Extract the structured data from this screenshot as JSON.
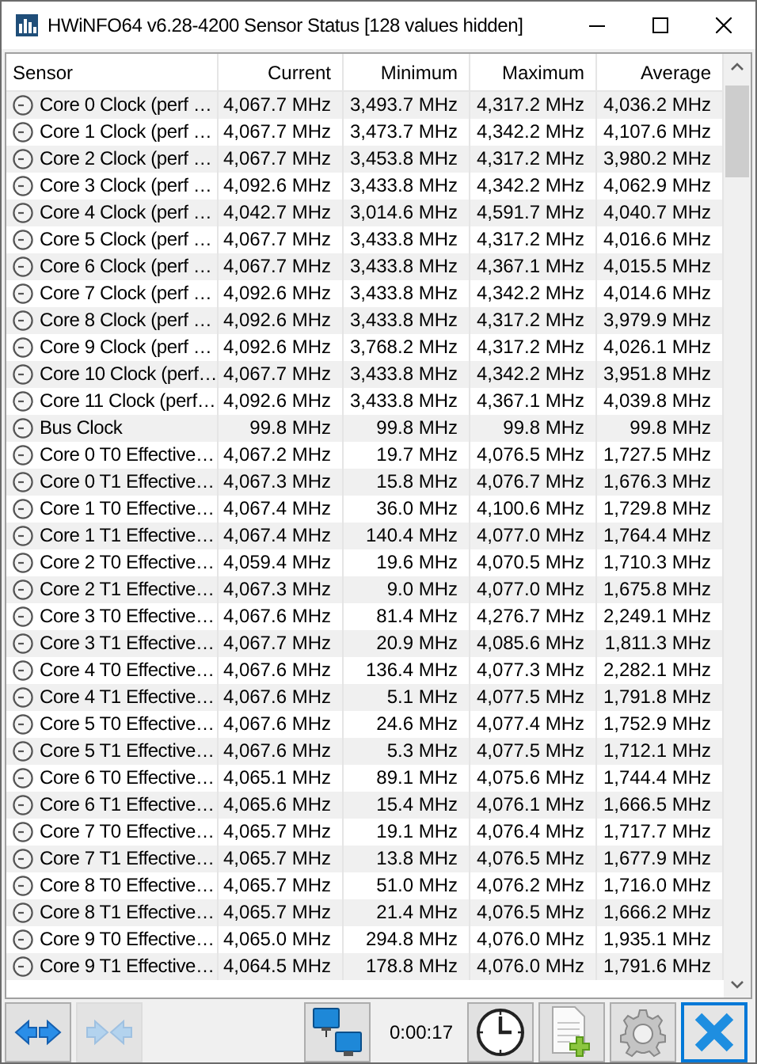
{
  "window": {
    "title": "HWiNFO64 v6.28-4200 Sensor Status [128 values hidden]"
  },
  "table": {
    "columns": [
      "Sensor",
      "Current",
      "Minimum",
      "Maximum",
      "Average"
    ],
    "rows": [
      [
        "Core 0 Clock (perf …",
        "4,067.7 MHz",
        "3,493.7 MHz",
        "4,317.2 MHz",
        "4,036.2 MHz"
      ],
      [
        "Core 1 Clock (perf …",
        "4,067.7 MHz",
        "3,473.7 MHz",
        "4,342.2 MHz",
        "4,107.6 MHz"
      ],
      [
        "Core 2 Clock (perf …",
        "4,067.7 MHz",
        "3,453.8 MHz",
        "4,317.2 MHz",
        "3,980.2 MHz"
      ],
      [
        "Core 3 Clock (perf …",
        "4,092.6 MHz",
        "3,433.8 MHz",
        "4,342.2 MHz",
        "4,062.9 MHz"
      ],
      [
        "Core 4 Clock (perf …",
        "4,042.7 MHz",
        "3,014.6 MHz",
        "4,591.7 MHz",
        "4,040.7 MHz"
      ],
      [
        "Core 5 Clock (perf …",
        "4,067.7 MHz",
        "3,433.8 MHz",
        "4,317.2 MHz",
        "4,016.6 MHz"
      ],
      [
        "Core 6 Clock (perf …",
        "4,067.7 MHz",
        "3,433.8 MHz",
        "4,367.1 MHz",
        "4,015.5 MHz"
      ],
      [
        "Core 7 Clock (perf …",
        "4,092.6 MHz",
        "3,433.8 MHz",
        "4,342.2 MHz",
        "4,014.6 MHz"
      ],
      [
        "Core 8 Clock (perf …",
        "4,092.6 MHz",
        "3,433.8 MHz",
        "4,317.2 MHz",
        "3,979.9 MHz"
      ],
      [
        "Core 9 Clock (perf …",
        "4,092.6 MHz",
        "3,768.2 MHz",
        "4,317.2 MHz",
        "4,026.1 MHz"
      ],
      [
        "Core 10 Clock (perf…",
        "4,067.7 MHz",
        "3,433.8 MHz",
        "4,342.2 MHz",
        "3,951.8 MHz"
      ],
      [
        "Core 11 Clock (perf…",
        "4,092.6 MHz",
        "3,433.8 MHz",
        "4,367.1 MHz",
        "4,039.8 MHz"
      ],
      [
        "Bus Clock",
        "99.8 MHz",
        "99.8 MHz",
        "99.8 MHz",
        "99.8 MHz"
      ],
      [
        "Core 0 T0 Effective…",
        "4,067.2 MHz",
        "19.7 MHz",
        "4,076.5 MHz",
        "1,727.5 MHz"
      ],
      [
        "Core 0 T1 Effective…",
        "4,067.3 MHz",
        "15.8 MHz",
        "4,076.7 MHz",
        "1,676.3 MHz"
      ],
      [
        "Core 1 T0 Effective…",
        "4,067.4 MHz",
        "36.0 MHz",
        "4,100.6 MHz",
        "1,729.8 MHz"
      ],
      [
        "Core 1 T1 Effective…",
        "4,067.4 MHz",
        "140.4 MHz",
        "4,077.0 MHz",
        "1,764.4 MHz"
      ],
      [
        "Core 2 T0 Effective…",
        "4,059.4 MHz",
        "19.6 MHz",
        "4,070.5 MHz",
        "1,710.3 MHz"
      ],
      [
        "Core 2 T1 Effective…",
        "4,067.3 MHz",
        "9.0 MHz",
        "4,077.0 MHz",
        "1,675.8 MHz"
      ],
      [
        "Core 3 T0 Effective…",
        "4,067.6 MHz",
        "81.4 MHz",
        "4,276.7 MHz",
        "2,249.1 MHz"
      ],
      [
        "Core 3 T1 Effective…",
        "4,067.7 MHz",
        "20.9 MHz",
        "4,085.6 MHz",
        "1,811.3 MHz"
      ],
      [
        "Core 4 T0 Effective…",
        "4,067.6 MHz",
        "136.4 MHz",
        "4,077.3 MHz",
        "2,282.1 MHz"
      ],
      [
        "Core 4 T1 Effective…",
        "4,067.6 MHz",
        "5.1 MHz",
        "4,077.5 MHz",
        "1,791.8 MHz"
      ],
      [
        "Core 5 T0 Effective…",
        "4,067.6 MHz",
        "24.6 MHz",
        "4,077.4 MHz",
        "1,752.9 MHz"
      ],
      [
        "Core 5 T1 Effective…",
        "4,067.6 MHz",
        "5.3 MHz",
        "4,077.5 MHz",
        "1,712.1 MHz"
      ],
      [
        "Core 6 T0 Effective…",
        "4,065.1 MHz",
        "89.1 MHz",
        "4,075.6 MHz",
        "1,744.4 MHz"
      ],
      [
        "Core 6 T1 Effective…",
        "4,065.6 MHz",
        "15.4 MHz",
        "4,076.1 MHz",
        "1,666.5 MHz"
      ],
      [
        "Core 7 T0 Effective…",
        "4,065.7 MHz",
        "19.1 MHz",
        "4,076.4 MHz",
        "1,717.7 MHz"
      ],
      [
        "Core 7 T1 Effective…",
        "4,065.7 MHz",
        "13.8 MHz",
        "4,076.5 MHz",
        "1,677.9 MHz"
      ],
      [
        "Core 8 T0 Effective…",
        "4,065.7 MHz",
        "51.0 MHz",
        "4,076.2 MHz",
        "1,716.0 MHz"
      ],
      [
        "Core 8 T1 Effective…",
        "4,065.7 MHz",
        "21.4 MHz",
        "4,076.5 MHz",
        "1,666.2 MHz"
      ],
      [
        "Core 9 T0 Effective…",
        "4,065.0 MHz",
        "294.8 MHz",
        "4,076.0 MHz",
        "1,935.1 MHz"
      ],
      [
        "Core 9 T1 Effective…",
        "4,064.5 MHz",
        "178.8 MHz",
        "4,076.0 MHz",
        "1,791.6 MHz"
      ]
    ]
  },
  "toolbar": {
    "elapsed": "0:00:17",
    "buttons": [
      {
        "kind": "expand",
        "disabled": false
      },
      {
        "kind": "collapse",
        "disabled": true
      },
      {
        "kind": "network",
        "disabled": false
      },
      {
        "kind": "clock",
        "disabled": false
      },
      {
        "kind": "report",
        "disabled": false
      },
      {
        "kind": "settings",
        "disabled": false
      },
      {
        "kind": "close",
        "disabled": false
      }
    ]
  }
}
